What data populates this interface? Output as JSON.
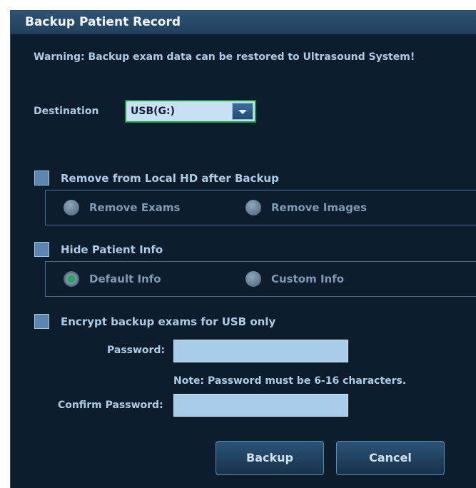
{
  "dialog": {
    "title": "Backup Patient Record",
    "warning": "Warning: Backup exam data can be restored to Ultrasound System!",
    "destination": {
      "label": "Destination",
      "value": "USB(G:)"
    },
    "remove_local": {
      "label": "Remove from Local HD after Backup",
      "checked": false,
      "options": [
        {
          "label": "Remove Exams",
          "selected": false
        },
        {
          "label": "Remove Images",
          "selected": false
        }
      ]
    },
    "hide_info": {
      "label": "Hide Patient Info",
      "checked": false,
      "options": [
        {
          "label": "Default Info",
          "selected": true
        },
        {
          "label": "Custom Info",
          "selected": false
        }
      ]
    },
    "encrypt": {
      "label": "Encrypt backup exams for USB only",
      "checked": false,
      "password_label": "Password:",
      "password_value": "",
      "note": "Note: Password must be 6-16 characters.",
      "confirm_label": "Confirm Password:",
      "confirm_value": ""
    },
    "buttons": {
      "backup": "Backup",
      "cancel": "Cancel"
    }
  },
  "colors": {
    "background": "#0d1d2d",
    "titlebar": "#2f5373",
    "label": "#aecbe4",
    "accent_green": "#1b9a3c",
    "input": "#a9cce9"
  }
}
